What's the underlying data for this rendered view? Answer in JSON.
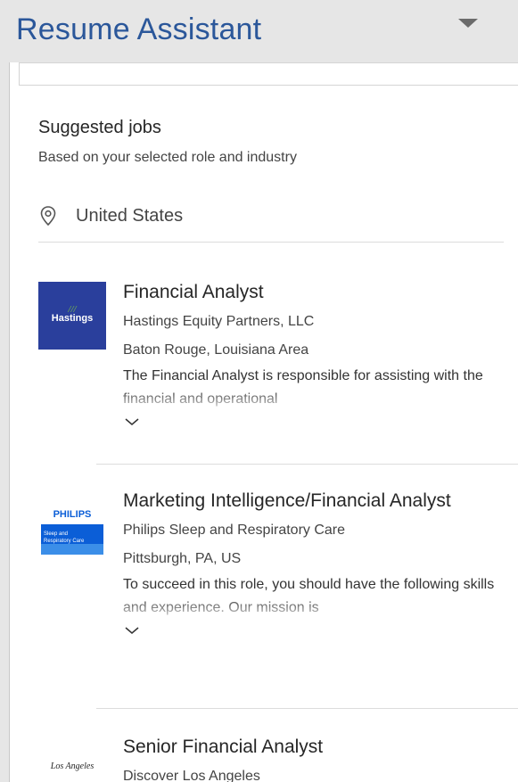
{
  "header": {
    "title": "Resume Assistant",
    "dropdown_icon": "chevron-down-icon"
  },
  "suggested": {
    "title": "Suggested jobs",
    "subtitle": "Based on your selected role and industry",
    "location_icon": "location-pin-icon",
    "location": "United States"
  },
  "jobs": [
    {
      "title": "Financial Analyst",
      "company": "Hastings Equity Partners, LLC",
      "location": "Baton Rouge, Louisiana Area",
      "description": "The Financial Analyst is responsible for assisting with the financial and operational",
      "logo_text": "Hastings",
      "logo_color": "#2a3f9c"
    },
    {
      "title": "Marketing Intelligence/Financial Analyst",
      "company": "Philips Sleep and Respiratory Care",
      "location": "Pittsburgh, PA, US",
      "description": "To succeed in this role, you should have the following skills and experience. Our mission is",
      "logo_text": "PHILIPS",
      "logo_subtext": "Sleep and Respiratory Care",
      "logo_color": "#0b5ed7"
    },
    {
      "title": "Senior Financial Analyst",
      "company": "Discover Los Angeles",
      "logo_text": "Los Angeles"
    }
  ],
  "colors": {
    "accent": "#2b579a",
    "background": "#e6e6e6"
  }
}
